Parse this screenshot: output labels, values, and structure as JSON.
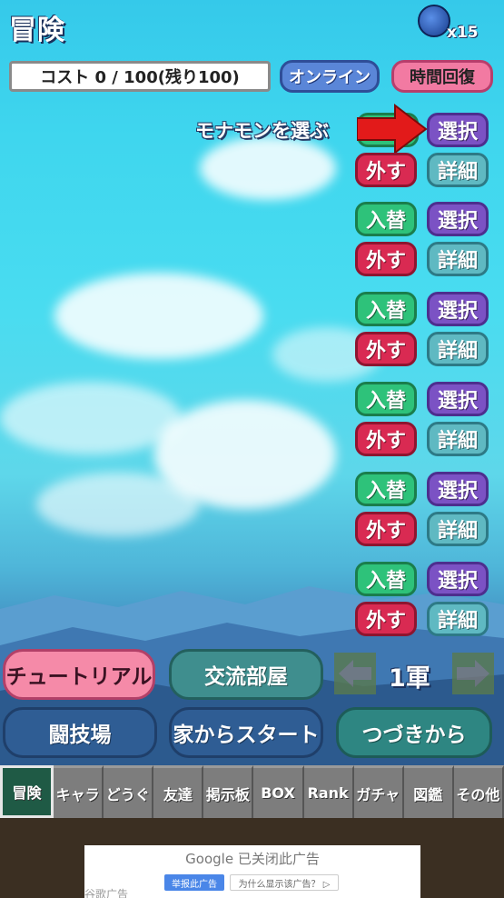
{
  "header": {
    "title": "冒険",
    "moon_count": "x15",
    "cost": "コスト 0 / 100(残り100)",
    "online_label": "オンライン",
    "time_recover_label": "時間回復"
  },
  "party": {
    "pick_label": "モナモンを選ぶ",
    "slots": [
      {
        "primary": "選択",
        "remove": "外す",
        "detail": "詳細"
      },
      {
        "swap": "入替",
        "select": "選択",
        "remove": "外す",
        "detail": "詳細"
      },
      {
        "swap": "入替",
        "select": "選択",
        "remove": "外す",
        "detail": "詳細"
      },
      {
        "swap": "入替",
        "select": "選択",
        "remove": "外す",
        "detail": "詳細"
      },
      {
        "swap": "入替",
        "select": "選択",
        "remove": "外す",
        "detail": "詳細"
      },
      {
        "swap": "入替",
        "select": "選択",
        "remove": "外す",
        "detail": "詳細"
      }
    ]
  },
  "actions": {
    "tutorial": "チュートリアル",
    "lobby": "交流部屋",
    "army": "1軍",
    "arena": "闘技場",
    "home_start": "家からスタート",
    "continue": "つづきから"
  },
  "tabs": [
    "冒険",
    "キャラ",
    "どうぐ",
    "友達",
    "掲示板",
    "BOX",
    "Rank",
    "ガチャ",
    "図鑑",
    "その他"
  ],
  "ad": {
    "closed": "Google 已关闭此广告",
    "report": "举报此广告",
    "why": "为什么显示该广告？ ▷",
    "footer": "谷歌广告"
  }
}
